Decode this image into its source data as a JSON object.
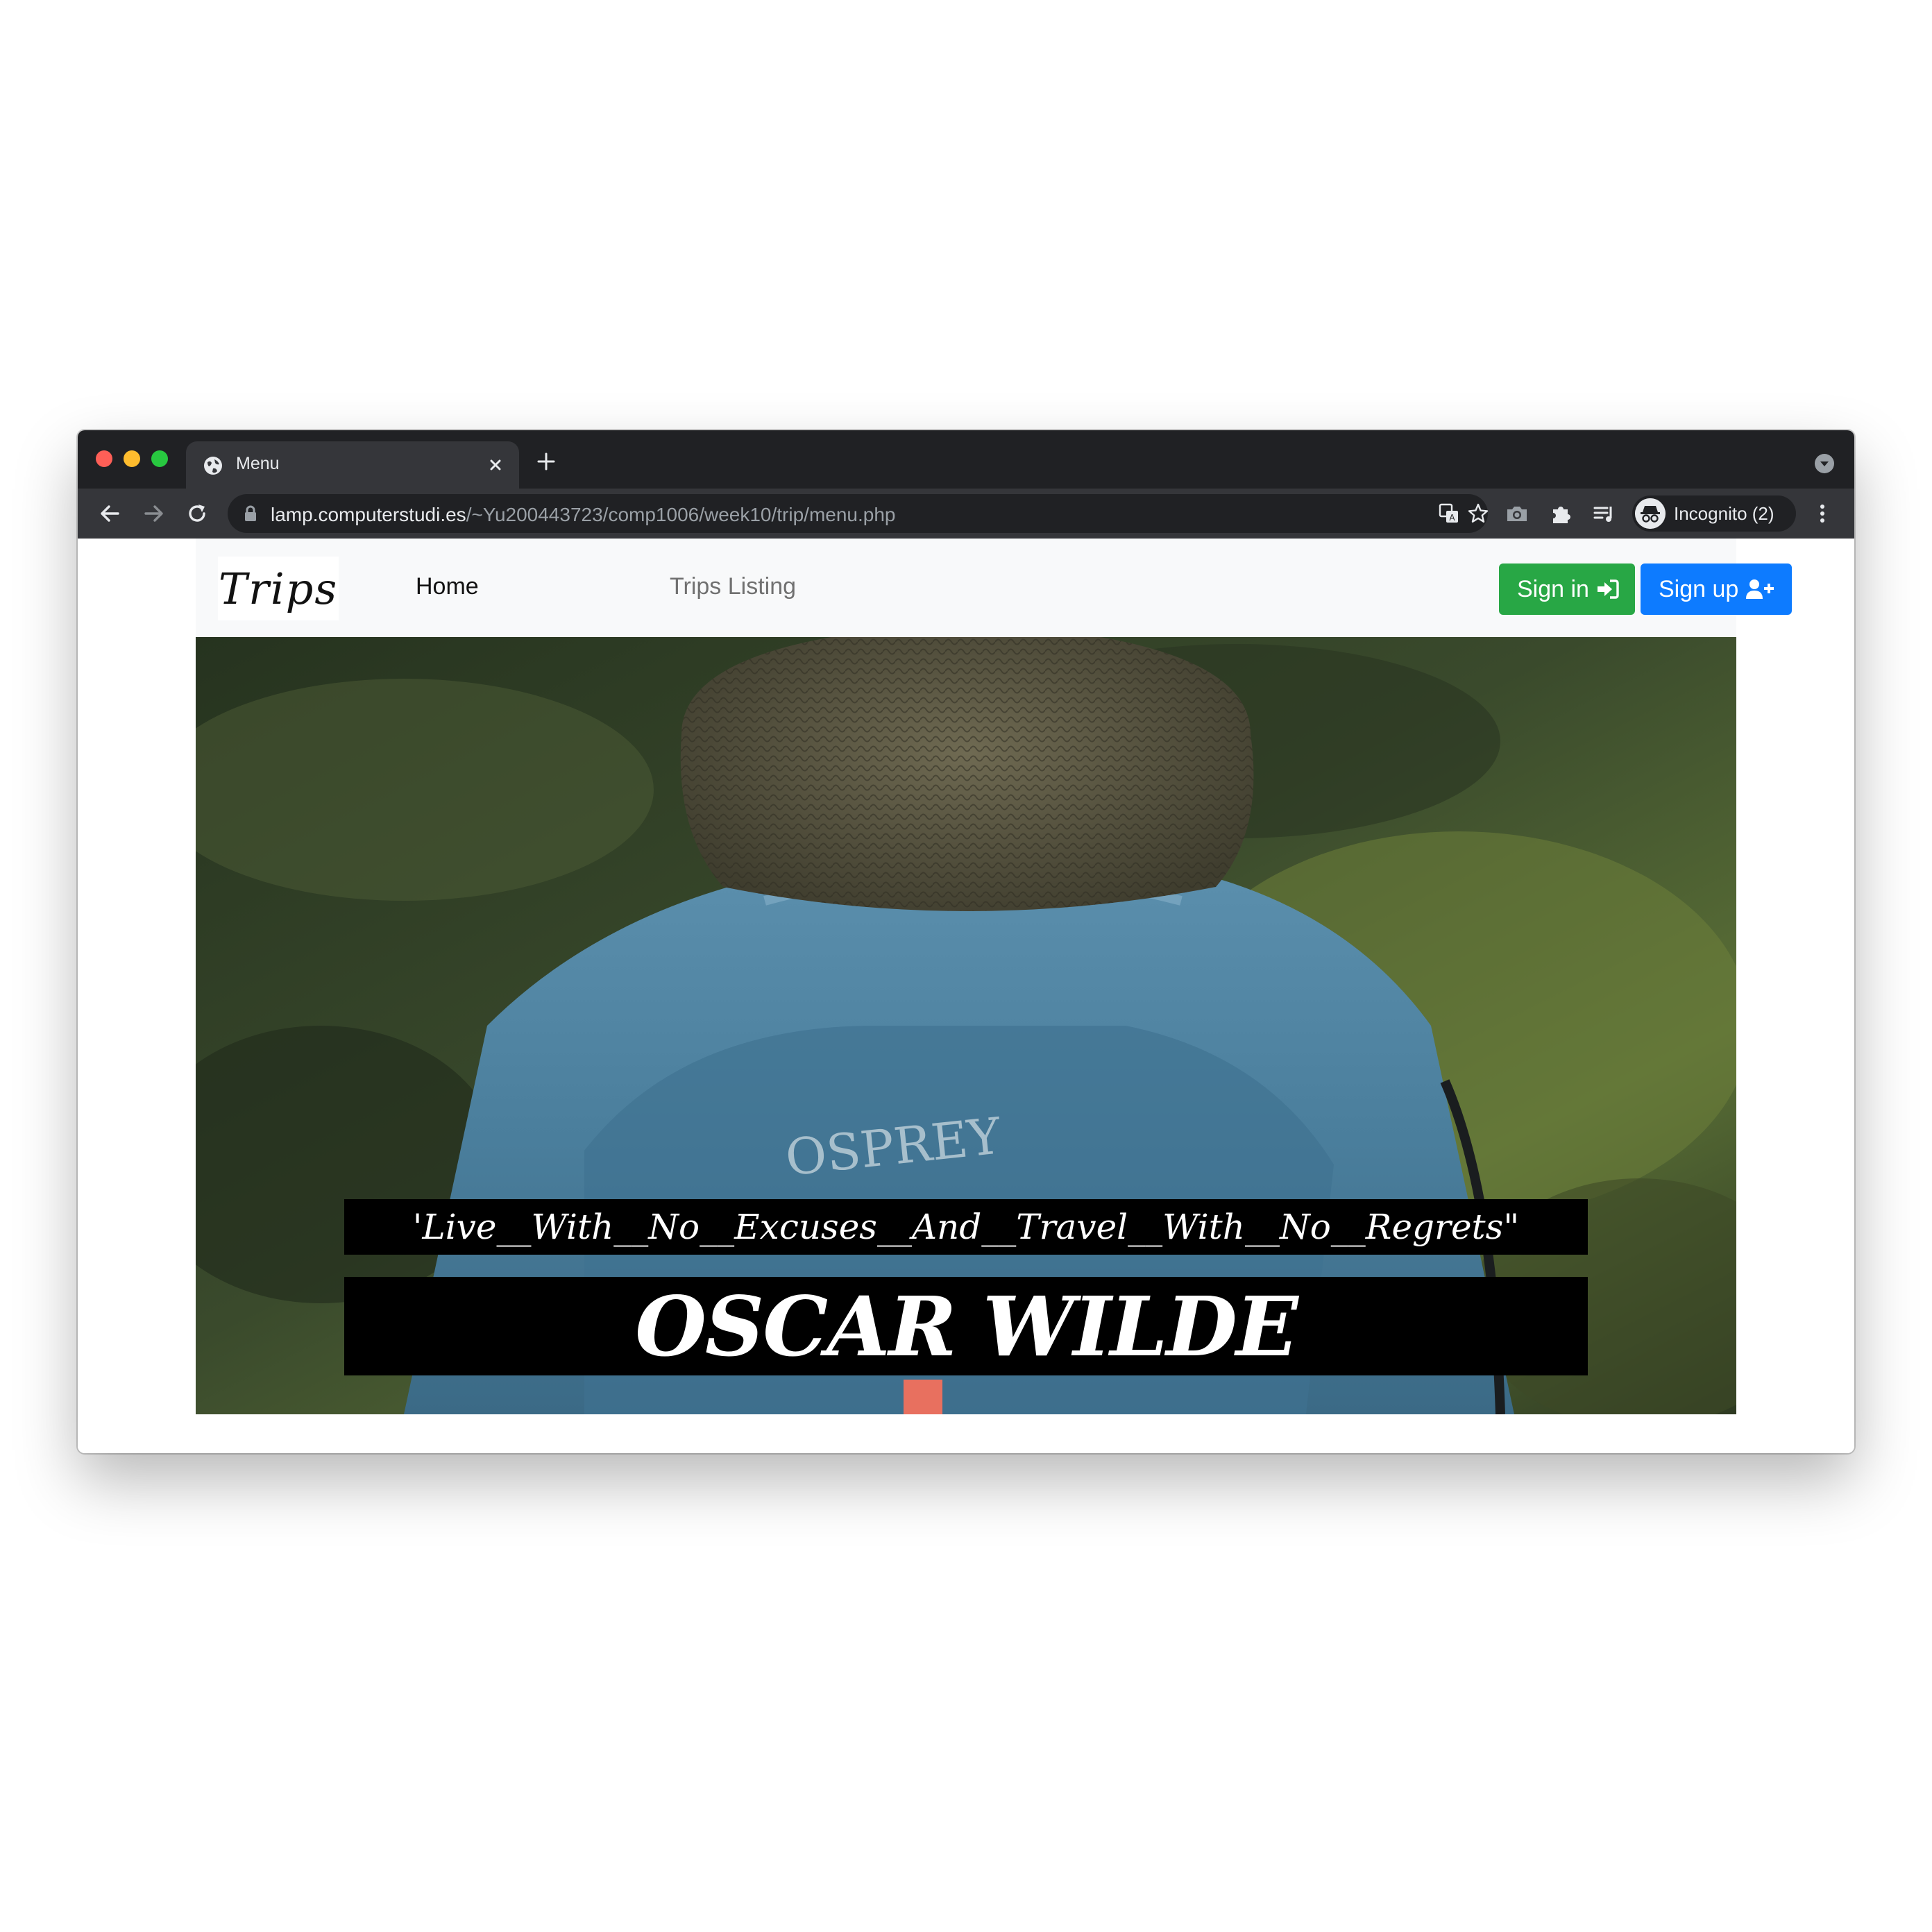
{
  "browser": {
    "tab_title": "Menu",
    "url_host": "lamp.computerstudi.es",
    "url_path": "/~Yu200443723/comp1006/week10/trip/menu.php",
    "profile_label": "Incognito (2)"
  },
  "site": {
    "brand": "Trips",
    "nav": {
      "home": "Home",
      "trips_listing": "Trips Listing"
    },
    "buttons": {
      "sign_in": "Sign in",
      "sign_up": "Sign up"
    },
    "hero": {
      "quote": "'Live__With__No__Excuses__And__Travel__With__No__Regrets\"",
      "author": "OSCAR WILDE",
      "backpack_brand": "OSPREY"
    }
  },
  "colors": {
    "sign_in": "#28a745",
    "sign_up": "#0d7bff",
    "chrome_dark": "#202124",
    "chrome_toolbar": "#35363a"
  }
}
